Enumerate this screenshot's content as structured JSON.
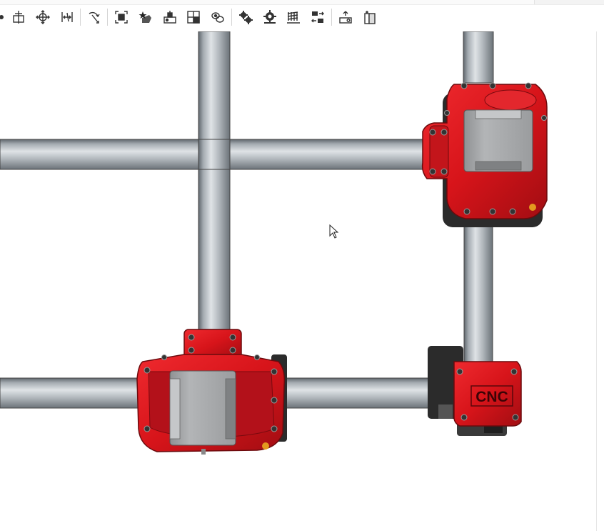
{
  "toolbar": {
    "tools": [
      {
        "icon": "partial-left-icon"
      },
      {
        "icon": "mate-connector-icon"
      },
      {
        "icon": "move-icon"
      },
      {
        "icon": "distance-icon"
      },
      {
        "icon": "rotate-arrow-icon"
      },
      {
        "icon": "frame-select-icon"
      },
      {
        "icon": "star-part-icon"
      },
      {
        "icon": "assembly-insert-icon"
      },
      {
        "icon": "grid-pattern-icon"
      },
      {
        "icon": "chain-link-icon"
      },
      {
        "icon": "gears-icon"
      },
      {
        "icon": "gear-single-icon"
      },
      {
        "icon": "array-spring-icon"
      },
      {
        "icon": "replicate-icon"
      },
      {
        "icon": "explode-icon"
      },
      {
        "icon": "section-view-icon"
      }
    ]
  },
  "viewport": {
    "label_text": "CNC",
    "colors": {
      "part_red": "#d7141a",
      "part_dark_red": "#9a0c10",
      "rod_light": "#c9ced3",
      "rod_mid": "#9aa1a8",
      "rod_dark": "#6e757c",
      "motor_gray": "#a7a9ab",
      "accent_orange": "#e39a1f",
      "black_part": "#2b2b2b"
    }
  }
}
